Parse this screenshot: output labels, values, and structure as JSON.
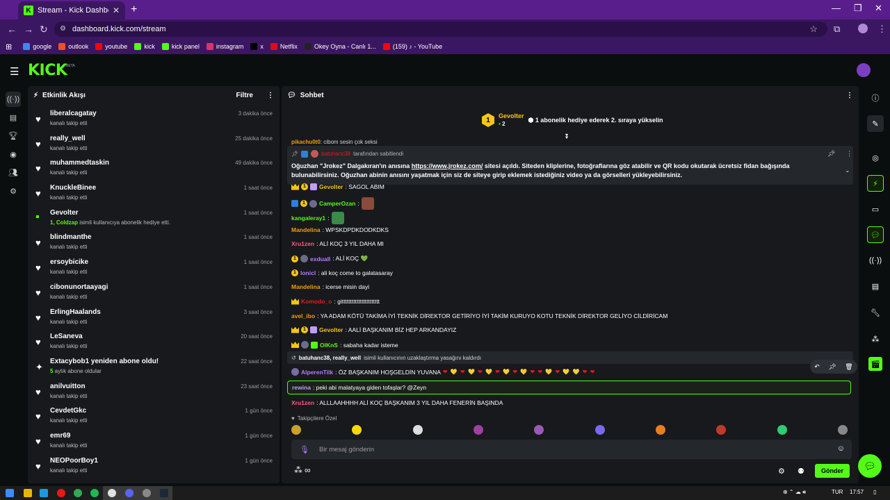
{
  "browser": {
    "tab_title": "Stream - Kick Dashboard",
    "favicon": "K",
    "url": "dashboard.kick.com/stream",
    "bookmarks": [
      {
        "label": "google",
        "icon": "google-icon",
        "color": "#4285f4"
      },
      {
        "label": "outlook",
        "icon": "outlook-icon",
        "color": "#f25022"
      },
      {
        "label": "youtube",
        "icon": "youtube-icon",
        "color": "#ff0000"
      },
      {
        "label": "kick",
        "icon": "kick-icon",
        "color": "#53fc18"
      },
      {
        "label": "kick panel",
        "icon": "kick-icon",
        "color": "#53fc18"
      },
      {
        "label": "instagram",
        "icon": "instagram-icon",
        "color": "#e1306c"
      },
      {
        "label": "x",
        "icon": "x-icon",
        "color": "#000000"
      },
      {
        "label": "Netflix",
        "icon": "netflix-icon",
        "color": "#e50914"
      },
      {
        "label": "Okey Oyna - Canlı 1...",
        "icon": "okey-icon",
        "color": "#222222"
      },
      {
        "label": "(159) ♪ - YouTube",
        "icon": "youtube-icon",
        "color": "#ff0000"
      }
    ]
  },
  "app": {
    "logo": "KICK",
    "logo_badge": "BETA"
  },
  "activity": {
    "title": "Etkinlik Akışı",
    "filter_label": "Filtre",
    "items": [
      {
        "name": "liberalcagatay",
        "sub": "kanalı takip etti",
        "time": "3 dakika önce",
        "type": "follow"
      },
      {
        "name": "really_well",
        "sub": "kanalı takip etti",
        "time": "25 dakika önce",
        "type": "follow"
      },
      {
        "name": "muhammedtaskin",
        "sub": "kanalı takip etti",
        "time": "49 dakika önce",
        "type": "follow"
      },
      {
        "name": "KnuckleBinee",
        "sub": "kanalı takip etti",
        "time": "1 saat önce",
        "type": "follow"
      },
      {
        "name": "Gevolter",
        "sub_highlight": "1, Coldzap",
        "sub": " isimli kullanıcıya abonelik hediye etti.",
        "time": "1 saat önce",
        "type": "gift"
      },
      {
        "name": "blindmanthe",
        "sub": "kanalı takip etti",
        "time": "1 saat önce",
        "type": "follow"
      },
      {
        "name": "ersoybicike",
        "sub": "kanalı takip etti",
        "time": "1 saat önce",
        "type": "follow"
      },
      {
        "name": "cibonunortaayagi",
        "sub": "kanalı takip etti",
        "time": "1 saat önce",
        "type": "follow"
      },
      {
        "name": "ErlingHaalands",
        "sub": "kanalı takip etti",
        "time": "3 saat önce",
        "type": "follow"
      },
      {
        "name": "LeSaneva",
        "sub": "kanalı takip etti",
        "time": "20 saat önce",
        "type": "follow"
      },
      {
        "name": "Extacybob1 yeniden abone oldu!",
        "sub_highlight": "5",
        "sub": " aylık abone oldular",
        "time": "22 saat önce",
        "type": "resub"
      },
      {
        "name": "anilvuitton",
        "sub": "kanalı takip etti",
        "time": "23 saat önce",
        "type": "follow"
      },
      {
        "name": "CevdetGkc",
        "sub": "kanalı takip etti",
        "time": "1 gün önce",
        "type": "follow"
      },
      {
        "name": "emr69",
        "sub": "kanalı takip etti",
        "time": "1 gün önce",
        "type": "follow"
      },
      {
        "name": "NEOPoorBoy1",
        "sub": "kanalı takip etti",
        "time": "1 gün önce",
        "type": "follow"
      }
    ]
  },
  "chat": {
    "title": "Sohbet",
    "leader": {
      "rank": "1",
      "name": "Gevolter",
      "count": "2",
      "text": "1 abonelik hediye ederek 2. sıraya yükselin"
    },
    "prev_line": {
      "user": "pikachu0t0",
      "text": ": cibom sesin çok seksi"
    },
    "pinned": {
      "by": "batuhanc38",
      "by_suffix": "tarafından sabitlendi",
      "text_a": "Oğuzhan \"Jrokez\" Dalgakıran'ın anısına ",
      "link": "https://www.jrokez.com/",
      "text_b": " sitesi açıldı. Siteden kliplerine, fotoğraflarına göz atabilir ve QR kodu okutarak ücretsiz fidan bağışında bulunabilirsiniz. Oğuzhan abinin anısını yaşatmak için siz de siteye girip eklemek istediğiniz video ya da görselleri yükleyebilirsiniz."
    },
    "messages": [
      {
        "user": "Gevolter",
        "color": "#f5c518",
        "text": ": SAGOL ABIM",
        "badges": [
          "crown",
          "num",
          "gift"
        ]
      },
      {
        "user": "CamperOzan",
        "color": "#53fc18",
        "text": ":",
        "badges": [
          "pin",
          "num",
          "av"
        ],
        "emote": "#8b4a3a"
      },
      {
        "user": "kangaleray1",
        "color": "#53fc18",
        "text": ":",
        "badges": [],
        "emote": "#3a8b4a"
      },
      {
        "user": "Mandelina",
        "color": "#f39c12",
        "text": ": WPSKDPDKDODKDKS",
        "badges": []
      },
      {
        "user": "Xru1zen",
        "color": "#ff5c7a",
        "text": ": ALİ KOÇ 3 YIL DAHA MI",
        "badges": []
      },
      {
        "user": "exduall",
        "color": "#b77cf7",
        "text": ": ALİ KOÇ 💚",
        "badges": [
          "num",
          "av"
        ]
      },
      {
        "user": "lonicl",
        "color": "#b77cf7",
        "text": ": ali koç come to galatasaray",
        "badges": [
          "num"
        ]
      },
      {
        "user": "Mandelina",
        "color": "#f39c12",
        "text": ": icerse misin dayi",
        "badges": []
      },
      {
        "user": "Komodo_o",
        "color": "#e91916",
        "text": ": gittttttttttttttttttttttt",
        "badges": [
          "crown"
        ]
      },
      {
        "user": "avel_ibo",
        "color": "#f39c12",
        "text": ": YA ADAM KÖTÜ TAKİMA İYİ TEKNİK DİREKTOR GETİRİYO İYİ TAKİM KURUYO KOTU TEKNİK DİREKTOR GELİYO CİLDİRİCAM",
        "badges": []
      },
      {
        "user": "Gevolter",
        "color": "#f5c518",
        "text": ": AALİ BAŞKANIM BİZ HEP ARKANDAYIZ",
        "badges": [
          "crown",
          "num",
          "gift"
        ]
      },
      {
        "user": "OlKnS",
        "color": "#53fc18",
        "text": ": sabaha kadar isteme",
        "badges": [
          "crown",
          "av",
          "giftg"
        ]
      }
    ],
    "system_line": {
      "users": "batuhanc38, really_well",
      "text": " isimli kullanıcının uzaklaştırma yasağını kaldırdı"
    },
    "alperen": {
      "user": "AlperenTilk",
      "color": "#b77cf7",
      "text": ": ÖZ BAŞKANIM HOŞGELDİN YUVANA",
      "hearts": "❤ 💛 ❤ 💛 ❤ 💛 ❤ 💛 ❤ 💛 ❤ ❤ 💛 ❤ 💛 💛 ❤ ❤"
    },
    "mention": {
      "user": "rewina",
      "text": ": peki abi malatyaya giden tofaşlar? @Zeyn"
    },
    "last": {
      "user": "Xru1zen",
      "color": "#ff5c7a",
      "text": ": ALLLAAHHHH ALİ KOÇ BAŞKANIM 3 YIL DAHA FENERİN BAŞINDA"
    },
    "follower_only": "Takipçilere Özel",
    "input_placeholder": "Bir mesaj gönderin",
    "send_label": "Gönder"
  },
  "taskbar": {
    "lang": "TUR",
    "time": "17:57"
  }
}
